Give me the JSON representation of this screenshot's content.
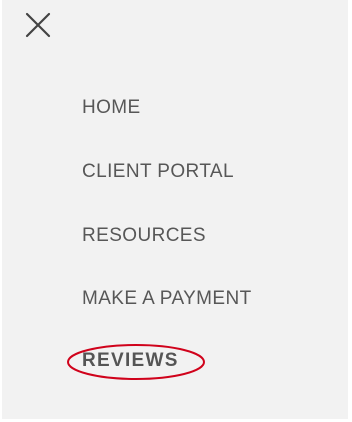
{
  "close_button": {
    "icon": "close-icon"
  },
  "nav": {
    "items": [
      {
        "label": "HOME"
      },
      {
        "label": "CLIENT PORTAL"
      },
      {
        "label": "RESOURCES"
      },
      {
        "label": "MAKE A PAYMENT"
      },
      {
        "label": "REVIEWS",
        "highlighted": true
      }
    ]
  },
  "colors": {
    "background": "#f2f2f2",
    "text": "#575757",
    "highlight": "#d0021b"
  }
}
